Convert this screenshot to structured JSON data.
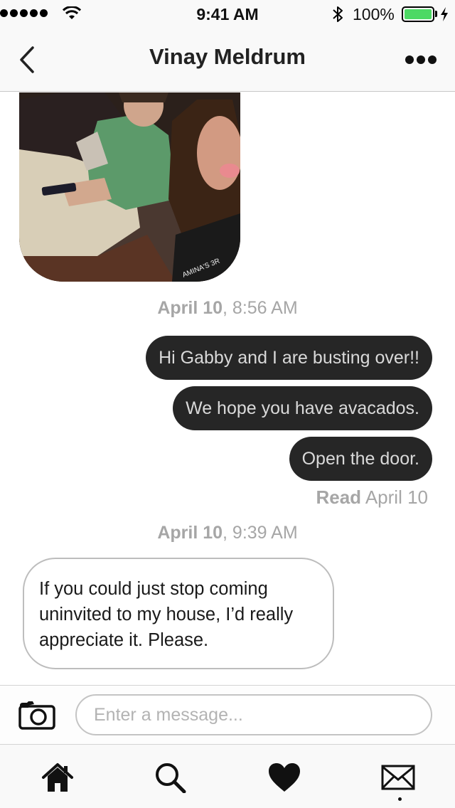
{
  "status_bar": {
    "time": "9:41 AM",
    "battery_percent": "100%",
    "signal_bars": 5,
    "battery_level": 1.0,
    "battery_color": "#4cd964"
  },
  "header": {
    "title": "Vinay Meldrum",
    "back_icon": "chevron-left-icon",
    "more_icon": "more-dots-icon"
  },
  "conversation": {
    "photo_text": "AMINA'S 3R",
    "timestamp_1": {
      "date": "April 10",
      "time": ", 8:56 AM"
    },
    "outgoing": [
      "Hi Gabby and I are busting over!!",
      "We hope you have avacados.",
      "Open the door."
    ],
    "read_receipt": {
      "label": "Read",
      "date": " April 10"
    },
    "timestamp_2": {
      "date": "April 10",
      "time": ", 9:39 AM"
    },
    "incoming": "If you could just stop coming uninvited to my house, I’d really appreciate it. Please."
  },
  "composer": {
    "placeholder": "Enter a message...",
    "camera_icon": "camera-icon"
  },
  "tab_bar": {
    "items": [
      "home-icon",
      "search-icon",
      "heart-icon",
      "mail-icon"
    ],
    "active": "mail-icon"
  },
  "colors": {
    "outgoing_bubble": "#262626",
    "outgoing_text": "#d9d9d9",
    "meta_text": "#a6a6a6"
  }
}
